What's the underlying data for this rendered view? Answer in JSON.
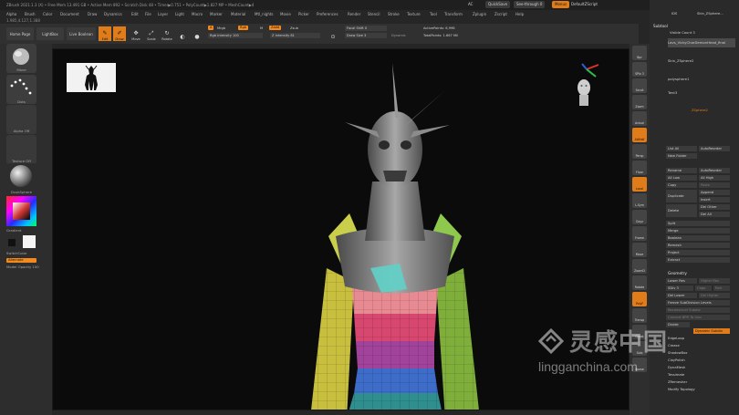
{
  "titlebar": {
    "text": "ZBrush 2021.1.3 (X)  • Free Mem 13.491 GB • Active Mem 892 • Scratch Disk 48 • Timer▶0.751 • PolyCount▶1.827 MP • MeshCount▶4",
    "ac": "AC",
    "quicksave": "QuickSave",
    "seethrough": "See-through 0",
    "menus": "Menus",
    "defaultzscript": "DefaultZScript"
  },
  "menu": [
    "Alpha",
    "Brush",
    "Color",
    "Document",
    "Draw",
    "Dynamics",
    "Edit",
    "File",
    "Layer",
    "Light",
    "Macro",
    "Marker",
    "Material",
    "Mtl_nights",
    "Movie",
    "Picker",
    "Preferences",
    "Render",
    "Stencil",
    "Stroke",
    "Texture",
    "Tool",
    "Transform",
    "Zplugin",
    "Zscript",
    "Help"
  ],
  "coords": "1.985,4.127,1.388",
  "shelf": {
    "home_page": "Home Page",
    "lightbox": "LightBox",
    "live_boolean": "Live Boolean",
    "edit": "Edit",
    "draw": "Draw",
    "move": "Move",
    "scale": "Scale",
    "rotate": "Rotate",
    "a_label": "A",
    "mrgb": "Mrgb",
    "rgb": "Rgb",
    "m": "M",
    "zadd": "Zadd",
    "zsub": "Zsub",
    "rgb_intensity": "Rgb Intensity 100",
    "z_intensity": "Z Intensity 81",
    "focal_shift": "Focal Shift 0",
    "draw_size": "Draw Size 3",
    "dynamic": "Dynamic",
    "active_points": "ActivePoints: 6,998",
    "total_points": "TotalPoints: 1.667 Mil"
  },
  "lefttray": {
    "move": "Move",
    "dots": "Dots",
    "alpha_off": "Alpha Off",
    "texture_off": "Texture Off",
    "matcap": "DuskSphere",
    "gradient": "Gradient",
    "switch_color": "SwitchColor",
    "alternate": "Alternate",
    "model_opacity": "Model Opacity 100"
  },
  "rshelf": [
    "Bpr",
    "SPix 3",
    "Scroll",
    "Zoom",
    "Actual",
    "AAHalf",
    "Persp",
    "Floor",
    "Local",
    "L.Sym",
    "Gxyz",
    "Frame",
    "Move",
    "ZoomD",
    "Rotate",
    "PolyF",
    "Transp",
    "Ghost",
    "Solo",
    "Xpose"
  ],
  "rtray": {
    "top_items": [
      "IDS",
      "Skin_ZSphere..."
    ],
    "subtool": "Subtool",
    "visible_count": "Visible Count 3",
    "subtools": [
      "Lavs_VickyCharDemonHead_final",
      "Skin_ZSphere2",
      "polysphere1",
      "Tent3"
    ],
    "zsphere_label": "ZSphere2",
    "list_all": "List All",
    "auto_reorder": "AutoReorder",
    "new_folder": "New Folder",
    "rename": "Rename",
    "all_low": "All Low",
    "all_high": "All High",
    "copy": "Copy",
    "paste": "Paste",
    "duplicate": "Duplicate",
    "append": "Append",
    "insert": "Insert",
    "delete": "Delete",
    "del_other": "Del Other",
    "del_all": "Del All",
    "split": "Split",
    "merge": "Merge",
    "boolean": "Boolean",
    "remesh": "Remesh",
    "project": "Project",
    "extract": "Extract",
    "geometry": "Geometry",
    "lower_res": "Lower Res",
    "higher_res": "Higher Res",
    "sdiv": "SDiv 3",
    "cage": "Cage",
    "rstr": "Rstr",
    "del_lower": "Del Lower",
    "del_higher": "Del Higher",
    "freeze_subd": "Freeze SubDivision Levels",
    "reconstruct": "Reconstruct Subdiv",
    "convert_bpr": "Convert BPR To Geo",
    "divide": "Divide",
    "dynamic_subdiv": "Dynamic Subdiv",
    "edgeloop": "EdgeLoop",
    "crease": "Crease",
    "shadowbox": "ShadowBox",
    "claypolish": "ClayPolish",
    "dynamesh": "DynaMesh",
    "tessimate": "Tessimate",
    "zremesher": "ZRemesher",
    "modify_topology": "Modify Topology"
  },
  "watermark": {
    "brand": "灵感中国",
    "url": "lingganchina.com"
  },
  "colors": {
    "accent": "#f28a1e",
    "canvas_bg": "#0b0b0b"
  }
}
